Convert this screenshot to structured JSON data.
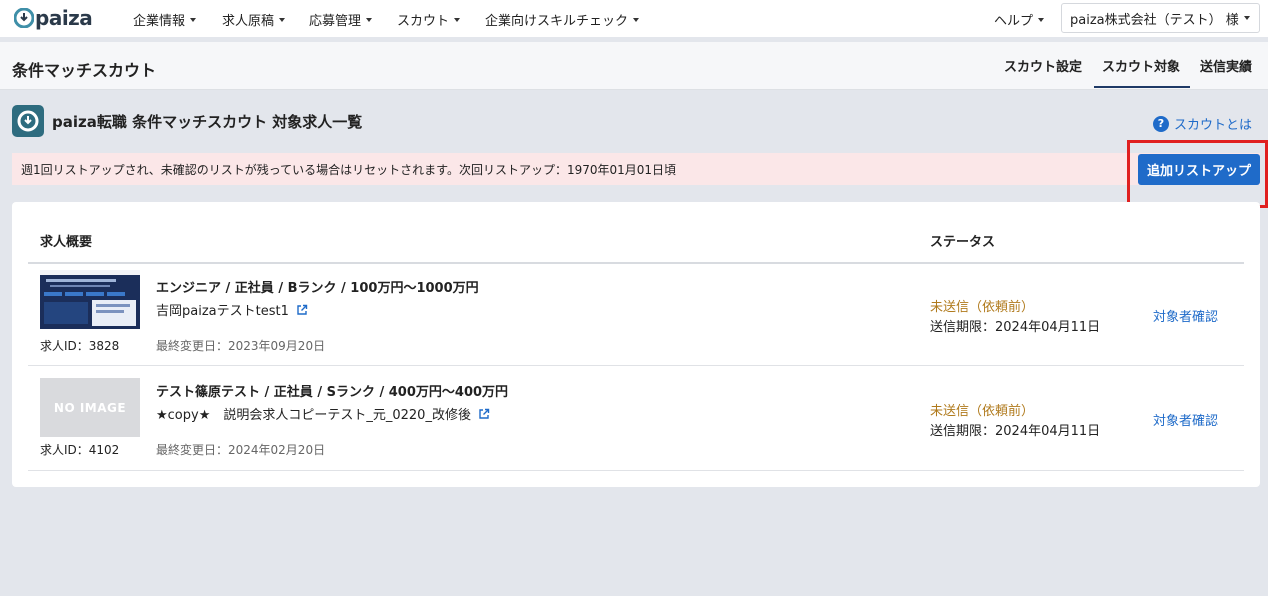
{
  "brand": {
    "name": "paiza"
  },
  "nav": {
    "items": [
      "企業情報",
      "求人原稿",
      "応募管理",
      "スカウト",
      "企業向けスキルチェック"
    ],
    "help": "ヘルプ",
    "company": "paiza株式会社（テスト） 様"
  },
  "subheader": {
    "title": "条件マッチスカウト",
    "tabs": [
      "スカウト設定",
      "スカウト対象",
      "送信実績"
    ],
    "active_tab": "スカウト対象"
  },
  "content": {
    "title": "paiza転職 条件マッチスカウト 対象求人一覧",
    "help_link": "スカウトとは",
    "alert": "週1回リストアップされ、未確認のリストが残っている場合はリセットされます。次回リストアップ：1970年01月01日頃",
    "add_button": "追加リストアップ"
  },
  "table": {
    "headers": [
      "求人概要",
      "ステータス"
    ],
    "rows": [
      {
        "title": "エンジニア / 正社員 / Bランク / 100万円〜1000万円",
        "company": "吉岡paizaテストtest1",
        "job_id": "求人ID：3828",
        "updated": "最終変更日：2023年09月20日",
        "status": "未送信（依頼前）",
        "deadline": "送信期限：2024年04月11日",
        "action": "対象者確認"
      },
      {
        "title": "テスト篠原テスト / 正社員 / Sランク / 400万円〜400万円",
        "company": "★copy★　説明会求人コピーテスト_元_0220_改修後",
        "job_id": "求人ID：4102",
        "updated": "最終変更日：2024年02月20日",
        "status": "未送信（依頼前）",
        "deadline": "送信期限：2024年04月11日",
        "action": "対象者確認",
        "thumb_text": "NO IMAGE"
      }
    ]
  },
  "colors": {
    "accent": "#1f6bc9",
    "status": "#b07a1c",
    "alert_bg": "#fbe7e8",
    "highlight": "#e02020"
  }
}
